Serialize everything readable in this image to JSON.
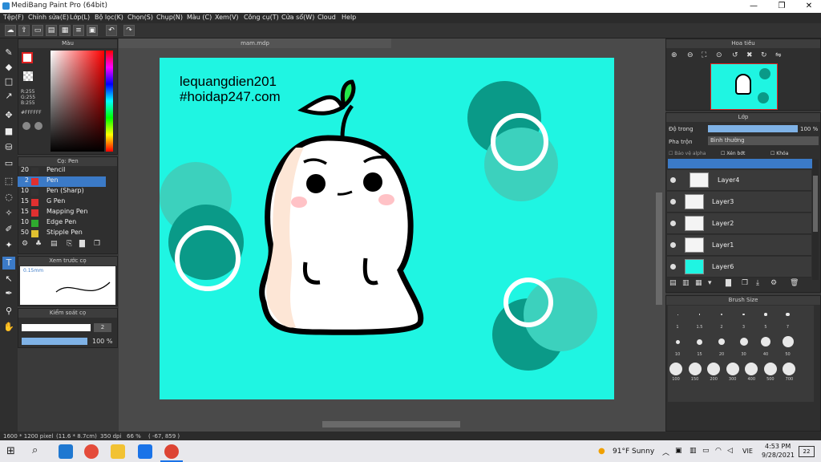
{
  "window": {
    "title": "MediBang Paint Pro (64bit)",
    "minimize": "—",
    "maximize": "❐",
    "close": "✕"
  },
  "menu": [
    "Tệp(F)",
    "Chỉnh sửa(E)",
    "Lớp(L)",
    "Bộ lọc(K)",
    "Chọn(S)",
    "Chụp(N)",
    "Màu (C)",
    "Xem(V)",
    "Công cụ(T)",
    "Cửa sổ(W)",
    "Cloud",
    "Help"
  ],
  "color_panel": {
    "title": "Màu",
    "r": "R:255",
    "g": "G:255",
    "b": "B:255",
    "hex": "#FFFFFF"
  },
  "brush_panel": {
    "title": "Cọ: Pen",
    "items": [
      {
        "size": "20",
        "name": "Pencil",
        "color": "#333333"
      },
      {
        "size": "2",
        "name": "Pen",
        "color": "#e03030"
      },
      {
        "size": "10",
        "name": "Pen (Sharp)",
        "color": "#333333"
      },
      {
        "size": "15",
        "name": "G Pen",
        "color": "#e03030"
      },
      {
        "size": "15",
        "name": "Mapping Pen",
        "color": "#e03030"
      },
      {
        "size": "10",
        "name": "Edge Pen",
        "color": "#2faa2f"
      },
      {
        "size": "50",
        "name": "Stipple Pen",
        "color": "#e0c030"
      }
    ]
  },
  "preview_panel": {
    "title": "Xem trước cọ",
    "size_label": "0.15mm"
  },
  "control_panel": {
    "title": "Kiểm soát cọ",
    "size_value": "2",
    "opacity": "100 %"
  },
  "document": {
    "tab": "mam.mdp"
  },
  "canvas_text": {
    "line1": "lequangdien201",
    "line2": "#hoidap247.com"
  },
  "navigator": {
    "title": "Hoa tiêu"
  },
  "layer_panel": {
    "title": "Lớp",
    "opacity_label": "Độ trong",
    "opacity_value": "100 %",
    "opacity_level": 1.0,
    "blend_label": "Pha trộn",
    "blend_value": "Bình thường",
    "opt_protect": "Bảo vệ alpha",
    "opt_clip": "Xén bớt",
    "opt_lock": "Khóa",
    "layers": [
      "Layer4",
      "Layer3",
      "Layer2",
      "Layer1",
      "Layer6"
    ]
  },
  "brush_size_panel": {
    "title": "Brush Size",
    "row1": [
      "1",
      "1.5",
      "2",
      "3",
      "5",
      "7"
    ],
    "row2": [
      "10",
      "15",
      "20",
      "30",
      "40",
      "50"
    ],
    "row3": [
      "100",
      "150",
      "200",
      "300",
      "400",
      "500",
      "700"
    ]
  },
  "status": {
    "size": "1600 * 1200 pixel",
    "cm": "(11.6 * 8.7cm)",
    "dpi": "350 dpi",
    "zoom": "66 %",
    "coords": "( -67, 859 )"
  },
  "taskbar": {
    "weather": "91°F  Sunny",
    "lang": "VIE",
    "time": "4:53 PM",
    "date": "9/28/2021",
    "badge": "22"
  }
}
